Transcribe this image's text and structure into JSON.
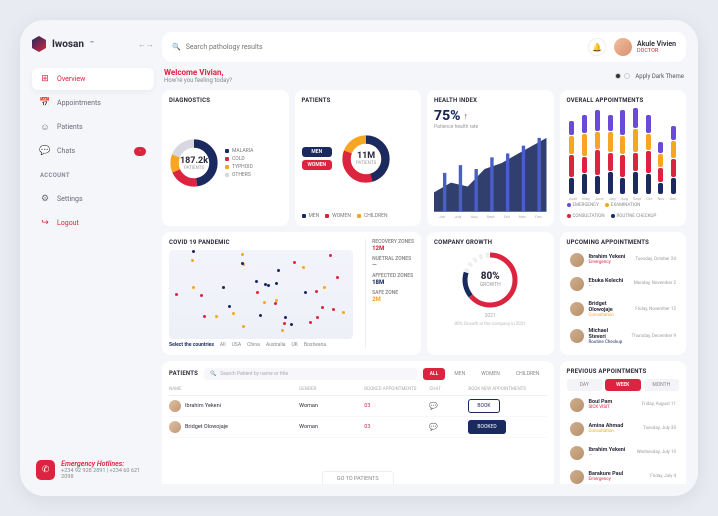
{
  "brand": {
    "name": "Iwosan",
    "tm": "™"
  },
  "search": {
    "placeholder": "Search pathology results"
  },
  "user": {
    "name": "Akule Vivien",
    "role": "DOCTOR"
  },
  "welcome": {
    "title": "Welcome Vivian,",
    "sub": "How're you feeling today?"
  },
  "theme": {
    "label": "Apply Dark Theme"
  },
  "nav": {
    "items": [
      {
        "label": "Overview",
        "icon": "⊞"
      },
      {
        "label": "Appointments",
        "icon": "📅"
      },
      {
        "label": "Patients",
        "icon": "☺"
      },
      {
        "label": "Chats",
        "icon": "💬",
        "badge": "·"
      }
    ],
    "section": "ACCOUNT",
    "account": [
      {
        "label": "Settings",
        "icon": "⚙"
      },
      {
        "label": "Logout",
        "icon": "↪"
      }
    ]
  },
  "hotlines": {
    "title": "Emergency Hotlines:",
    "nums": "+234 92 928 2891 | +234 60 621 2098"
  },
  "diagnostics": {
    "title": "DIAGNOSTICS",
    "value": "187.2k",
    "sub": "PATIENTS",
    "legend": [
      "MALARIA",
      "COLD",
      "TYPHOID",
      "OTHERS"
    ],
    "colors": [
      "#1a2a5e",
      "#dc2440",
      "#f6a623",
      "#d8d8e0"
    ],
    "labels": {
      "top": "MALARIA",
      "bottom": "OTHERS"
    }
  },
  "patients": {
    "title": "PATIENTS",
    "value": "11M",
    "sub": "PATIENTS",
    "pills": [
      {
        "label": "MEN",
        "color": "#1a2a5e"
      },
      {
        "label": "WOMEN",
        "color": "#dc2440"
      }
    ],
    "legend": [
      "MEN",
      "WOMEN",
      "CHILDREN"
    ],
    "colors": [
      "#1a2a5e",
      "#dc2440",
      "#f6a623"
    ]
  },
  "health": {
    "title": "HEALTH INDEX",
    "value": "75%",
    "sub": "Patience health rate",
    "axis": [
      "Jun",
      "July",
      "Aug",
      "Sept",
      "Oct",
      "Nov",
      "Dec"
    ]
  },
  "overall": {
    "title": "OVERALL APPOINTMENTS",
    "axis": [
      "April",
      "May",
      "June",
      "July",
      "Aug",
      "Sept",
      "Oct",
      "Nov",
      "Dec"
    ],
    "legend": [
      {
        "label": "EMERGENCY",
        "color": "#6a4ad9"
      },
      {
        "label": "EXAMINATION",
        "color": "#f6a623"
      },
      {
        "label": "CONSULTATION",
        "color": "#dc2440"
      },
      {
        "label": "ROUTINE CHECKUP",
        "color": "#1a2a5e"
      }
    ]
  },
  "covid": {
    "title": "COVID 19 PANDEMIC",
    "select_label": "Select the countries",
    "tabs": [
      "All",
      "USA",
      "China",
      "Australia",
      "UK",
      "Bostwana"
    ],
    "zones": [
      {
        "label": "RECOVERY ZONES",
        "value": "12M",
        "color": "#dc2440"
      },
      {
        "label": "NUETRAL ZONES",
        "value": "—",
        "color": "#888"
      },
      {
        "label": "AFFECTED ZONES",
        "value": "18M",
        "color": "#1a2a5e"
      },
      {
        "label": "SAFE ZONE",
        "value": "2M",
        "color": "#f6a623"
      }
    ]
  },
  "growth": {
    "title": "COMPANY GROWTH",
    "value": "80%",
    "sub": "GROWTH",
    "year": "2021",
    "note": "80% Growth in the company in 2021"
  },
  "upcoming": {
    "title": "UPCOMING APPOINTMENTS",
    "items": [
      {
        "name": "Ibrahim Yekeni",
        "type": "Emergency",
        "color": "#dc2440",
        "date": "Tuesday, October 24"
      },
      {
        "name": "Ebuka Kelechi",
        "type": "—",
        "color": "#888",
        "date": "Monday, November 2"
      },
      {
        "name": "Bridget Olowojaje",
        "type": "Consultation",
        "color": "#f6a623",
        "date": "Friday, November 12"
      },
      {
        "name": "Michael Steveri",
        "type": "Routine Checkup",
        "color": "#1a2a5e",
        "date": "Thursday, December 9"
      }
    ]
  },
  "previous": {
    "title": "PREVIOUS APPOINTMENTS",
    "tabs": [
      "DAY",
      "WEEK",
      "MONTH"
    ],
    "active_tab": 1,
    "items": [
      {
        "name": "Boul Pam",
        "type": "SICK VISIT",
        "color": "#dc2440",
        "date": "Friday, August 11"
      },
      {
        "name": "Amina Ahmad",
        "type": "Consultation",
        "color": "#f6a623",
        "date": "Tuesday, July 30"
      },
      {
        "name": "Ibrahim Yekeni",
        "type": "—",
        "color": "#888",
        "date": "Wednesday, July 10"
      },
      {
        "name": "Barakure Paul",
        "type": "Emergency",
        "color": "#dc2440",
        "date": "Friday, July 4"
      }
    ]
  },
  "patient_table": {
    "title": "PATIENTS",
    "search_placeholder": "Search Patient by name or title",
    "filters": [
      "ALL",
      "MEN",
      "WOMEN",
      "CHILDREN"
    ],
    "active_filter": 0,
    "cols": [
      "NAME",
      "GENDER",
      "BOOKED APPOINTMENTS",
      "CHAT",
      "BOOK NEW APPOINTMENTS"
    ],
    "rows": [
      {
        "name": "Ibrahim Yekeni",
        "gender": "Woman",
        "booked": "03",
        "book": "BOOK",
        "booked_state": false
      },
      {
        "name": "Bridget Olowojaje",
        "gender": "Woman",
        "booked": "03",
        "book": "BOOKED",
        "booked_state": true
      }
    ],
    "goto": "GO TO PATIENTS"
  },
  "chart_data": [
    {
      "type": "pie",
      "title": "DIAGNOSTICS",
      "categories": [
        "MALARIA",
        "COLD",
        "TYPHOID",
        "OTHERS"
      ],
      "values": [
        48,
        20,
        12,
        20
      ]
    },
    {
      "type": "pie",
      "title": "PATIENTS",
      "categories": [
        "MEN",
        "WOMEN",
        "CHILDREN"
      ],
      "values": [
        45,
        35,
        20
      ]
    },
    {
      "type": "area",
      "title": "HEALTH INDEX",
      "x": [
        "Jun",
        "July",
        "Aug",
        "Sept",
        "Oct",
        "Nov",
        "Dec"
      ],
      "series": [
        {
          "name": "index",
          "values": [
            30,
            38,
            35,
            50,
            55,
            62,
            75
          ]
        }
      ],
      "ylim": [
        0,
        100
      ]
    },
    {
      "type": "bar",
      "title": "OVERALL APPOINTMENTS",
      "categories": [
        "April",
        "May",
        "June",
        "July",
        "Aug",
        "Sept",
        "Oct",
        "Nov",
        "Dec"
      ],
      "series": [
        {
          "name": "EMERGENCY",
          "values": [
            8,
            10,
            12,
            9,
            14,
            11,
            10,
            6,
            8
          ]
        },
        {
          "name": "EXAMINATION",
          "values": [
            10,
            12,
            9,
            11,
            10,
            13,
            9,
            7,
            9
          ]
        },
        {
          "name": "CONSULTATION",
          "values": [
            12,
            9,
            14,
            10,
            12,
            10,
            12,
            8,
            10
          ]
        },
        {
          "name": "ROUTINE CHECKUP",
          "values": [
            9,
            11,
            10,
            12,
            9,
            12,
            11,
            6,
            9
          ]
        }
      ]
    }
  ]
}
